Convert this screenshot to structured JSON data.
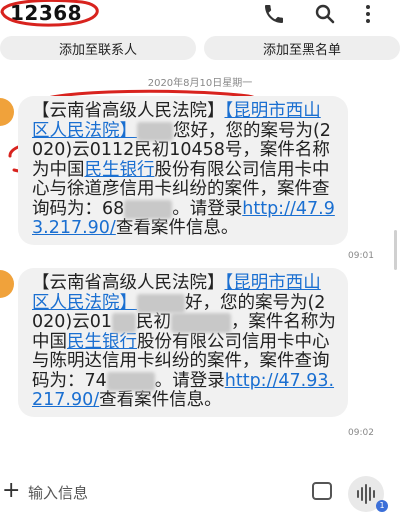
{
  "header": {
    "sender": "12368",
    "icons": [
      "phone-icon",
      "search-icon",
      "more-icon"
    ]
  },
  "actions": {
    "add_contact": "添加至联系人",
    "add_blacklist": "添加至黑名单"
  },
  "date_divider": "2020年8月10日星期一",
  "messages": [
    {
      "seg1": "【云南省高级人民法院】",
      "link1": "【昆明市西山区人民法院】",
      "seg2": "您好，您的案号为(2020)云0112民初10458号，案件名称为中国",
      "link2": "民生银行",
      "seg3": "股份有限公司信用卡中心与徐道彦信用卡纠纷的案件，案件查询码为：68",
      "seg4": "。请登录",
      "link3": "http://47.93.217.90/",
      "seg5": "查看案件信息。",
      "time": "09:01"
    },
    {
      "seg1": "【云南省高级人民法院】",
      "link1": "【昆明市西山区人民法院】",
      "seg2": "好，您的案号为(2020)云01",
      "seg3": "民初",
      "seg4": "，案件名称为中国",
      "link2": "民生银行",
      "seg5": "股份有限公司信用卡中心与陈明达信用卡纠纷的案件，案件查询码为：74",
      "seg6": "。请登录",
      "link3": "http://47.93.217.90/",
      "seg7": "查看案件信息。",
      "time": "09:02"
    }
  ],
  "composer": {
    "placeholder": "输入信息",
    "voice_badge": "1"
  },
  "colors": {
    "link": "#1a6fd1",
    "annotation": "#d8231e",
    "avatar": "#f0a23b",
    "bubble": "#f1f1f1"
  }
}
